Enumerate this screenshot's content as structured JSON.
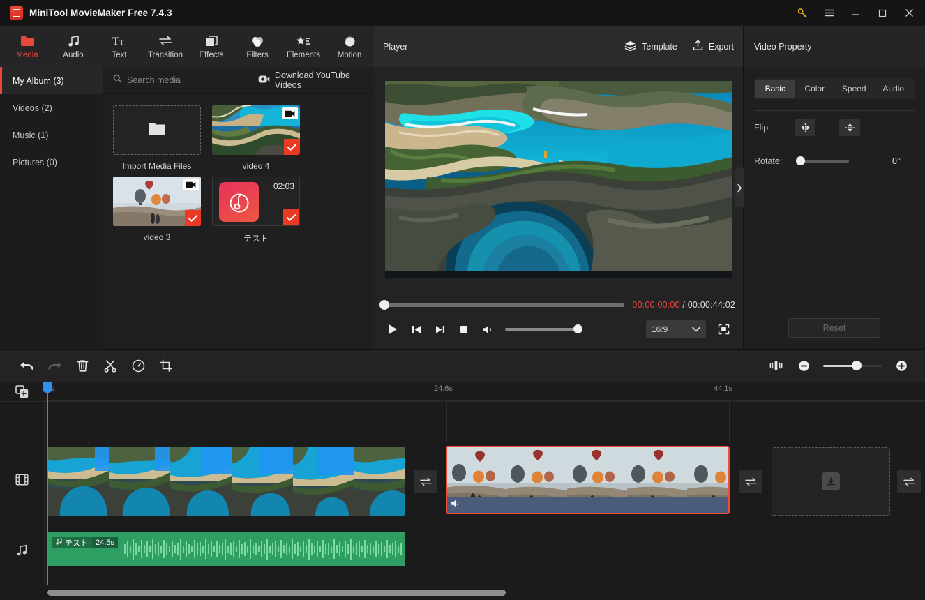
{
  "titlebar": {
    "app_title": "MiniTool MovieMaker Free 7.4.3",
    "logo_icon": "app-logo-icon",
    "buttons": [
      {
        "name": "key-icon",
        "glyph": "⚷"
      },
      {
        "name": "menu-icon",
        "glyph": "☰"
      },
      {
        "name": "minimize-icon",
        "glyph": "─"
      },
      {
        "name": "maximize-icon",
        "glyph": "□"
      },
      {
        "name": "close-icon",
        "glyph": "✕"
      }
    ]
  },
  "ribbon": {
    "items": [
      {
        "label": "Media",
        "icon": "folder-icon",
        "active": true
      },
      {
        "label": "Audio",
        "icon": "music-note-icon",
        "active": false
      },
      {
        "label": "Text",
        "icon": "text-icon",
        "active": false
      },
      {
        "label": "Transition",
        "icon": "transition-arrows-icon",
        "active": false
      },
      {
        "label": "Effects",
        "icon": "effects-squares-icon",
        "active": false
      },
      {
        "label": "Filters",
        "icon": "filters-circles-icon",
        "active": false
      },
      {
        "label": "Elements",
        "icon": "elements-star-icon",
        "active": false
      },
      {
        "label": "Motion",
        "icon": "motion-circle-icon",
        "active": false
      }
    ]
  },
  "library": {
    "albums": [
      {
        "label": "My Album (3)",
        "active": true
      },
      {
        "label": "Videos (2)",
        "active": false
      },
      {
        "label": "Music (1)",
        "active": false
      },
      {
        "label": "Pictures (0)",
        "active": false
      }
    ],
    "search": {
      "placeholder": "Search media",
      "value": "",
      "icon": "search-icon"
    },
    "download_youtube": {
      "label": "Download YouTube Videos",
      "icon": "youtube-download-icon"
    },
    "import_tile": {
      "label": "Import Media Files",
      "icon": "folder-icon"
    },
    "media_items": [
      {
        "name": "video 4",
        "type": "video",
        "checked": true,
        "duration": "",
        "thumb": "coast"
      },
      {
        "name": "video 3",
        "type": "video",
        "checked": true,
        "duration": "",
        "thumb": "balloon"
      },
      {
        "name": "テスト",
        "type": "audio",
        "checked": true,
        "duration": "02:03",
        "thumb": "audio"
      }
    ]
  },
  "player": {
    "title": "Player",
    "template_button": {
      "label": "Template",
      "icon": "layers-icon"
    },
    "export_button": {
      "label": "Export",
      "icon": "export-upload-icon"
    },
    "current_time": "00:00:00:00",
    "time_separator": " / ",
    "total_time": "00:00:44:02",
    "progress_percent": 0,
    "volume_percent": 100,
    "aspect_ratio": "16:9",
    "controls": [
      {
        "name": "play-button",
        "icon": "play-icon"
      },
      {
        "name": "previous-frame-button",
        "icon": "previous-icon"
      },
      {
        "name": "next-frame-button",
        "icon": "next-icon"
      },
      {
        "name": "stop-button",
        "icon": "stop-icon"
      },
      {
        "name": "volume-button",
        "icon": "speaker-icon"
      }
    ],
    "fullscreen_icon": "fullscreen-icon",
    "collapse_handle": "❯"
  },
  "property_panel": {
    "title": "Video Property",
    "tabs": [
      {
        "label": "Basic",
        "active": true
      },
      {
        "label": "Color",
        "active": false
      },
      {
        "label": "Speed",
        "active": false
      },
      {
        "label": "Audio",
        "active": false
      }
    ],
    "flip_label": "Flip:",
    "flip_horizontal_icon": "flip-horizontal-icon",
    "flip_vertical_icon": "flip-vertical-icon",
    "rotate_label": "Rotate:",
    "rotate_value": "0°",
    "rotate_percent": 0,
    "reset_label": "Reset"
  },
  "timeline_toolbar": {
    "tools": [
      {
        "name": "undo-button",
        "icon": "undo-arrow-icon",
        "disabled": false
      },
      {
        "name": "redo-button",
        "icon": "redo-arrow-icon",
        "disabled": true
      },
      {
        "name": "delete-button",
        "icon": "trash-icon",
        "disabled": false
      },
      {
        "name": "split-button",
        "icon": "scissors-icon",
        "disabled": false
      },
      {
        "name": "speed-button",
        "icon": "speedometer-icon",
        "disabled": false
      },
      {
        "name": "crop-button",
        "icon": "crop-icon",
        "disabled": false
      }
    ],
    "fit_timeline_icon": "fit-timeline-icon",
    "zoom_out_icon": "zoom-out-icon",
    "zoom_in_icon": "zoom-in-icon",
    "zoom_percent": 50
  },
  "timeline": {
    "add_track_icon": "add-track-icon",
    "ruler_ticks": [
      "0s",
      "24.6s",
      "44.1s"
    ],
    "playhead_time": "0s",
    "tracks": [
      {
        "name": "text-track",
        "icon": ""
      },
      {
        "name": "video-track",
        "icon": "film-strip-icon"
      },
      {
        "name": "audio-track",
        "icon": "music-note-icon"
      }
    ],
    "video_clips": [
      {
        "name": "video 4 clip",
        "thumb": "coast",
        "selected": false,
        "frames": 6,
        "has_audio_bar": false
      },
      {
        "name": "video 3 clip",
        "thumb": "balloon",
        "selected": true,
        "frames": 5,
        "has_audio_bar": true,
        "mute_icon": "speaker-icon"
      }
    ],
    "transition_slots": 3,
    "transition_icon": "transition-arrows-icon",
    "drop_zone": {
      "name": "add-media-dropzone",
      "icon": "download-box-icon"
    },
    "audio_clips": [
      {
        "label": "テスト",
        "duration": "24.5s",
        "icon": "music-note-icon"
      }
    ]
  },
  "colors": {
    "accent_red": "#e8473c",
    "selection_red": "#ef4b38",
    "playhead_blue": "#2f8ff0",
    "audio_green": "#2f9e63",
    "key_gold": "#e8b424"
  }
}
